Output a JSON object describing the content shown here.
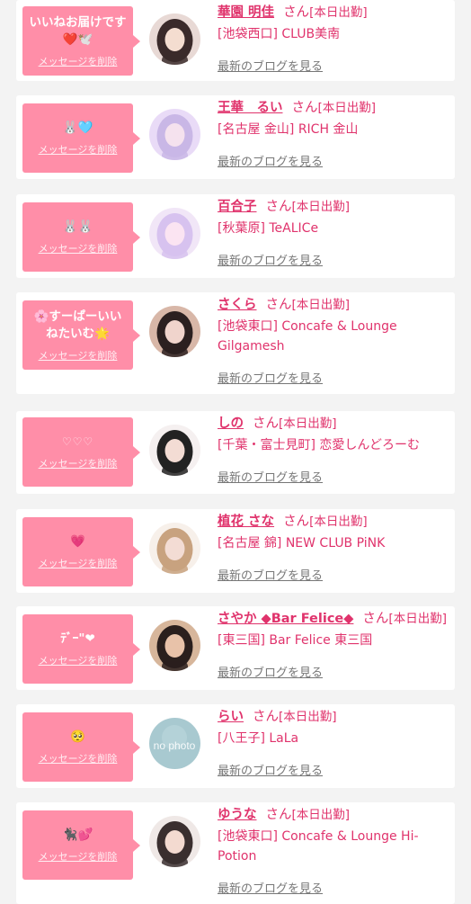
{
  "delete_label": "メッセージを削除",
  "blog_label": "最新のブログを見る",
  "san_label": "さん",
  "status_label": "[本日出勤]",
  "colors": {
    "accent": "#e0336c",
    "bubble": "#ff8ea8",
    "background": "#f3f3f3",
    "muted": "#777777"
  },
  "cards": [
    {
      "message": "いいねお届けです❤️🕊️",
      "name": "華園 明佳",
      "shop": "[池袋西口] CLUB美南"
    },
    {
      "message": "🐰🩵",
      "name": "王華　るい",
      "shop": "[名古屋 金山] RICH 金山"
    },
    {
      "message": "🐰🐰",
      "name": "百合子",
      "shop": "[秋葉原] TeALICe"
    },
    {
      "message": "🌸すーぱーいいねたいむ🌟",
      "name": "さくら",
      "shop": "[池袋東口] Concafe & Lounge Gilgamesh"
    },
    {
      "message": "♡♡♡",
      "name": "しの",
      "shop": "[千葉・富士見町] 恋愛しんどろーむ"
    },
    {
      "message": "💗",
      "name": "植花 さな",
      "shop": "[名古屋 錦] NEW CLUB PiNK"
    },
    {
      "message": "ﾃﾞｰ\"❤",
      "name": "さやか ◆Bar Felice◆",
      "shop": "[東三国] Bar Felice 東三国"
    },
    {
      "message": "🥺",
      "name": "らい",
      "shop": "[八王子] LaLa",
      "avatar_text": "no photo"
    },
    {
      "message": "🐈‍⬛💕",
      "name": "ゆうな",
      "shop": "[池袋東口] Concafe & Lounge Hi-Potion"
    }
  ]
}
